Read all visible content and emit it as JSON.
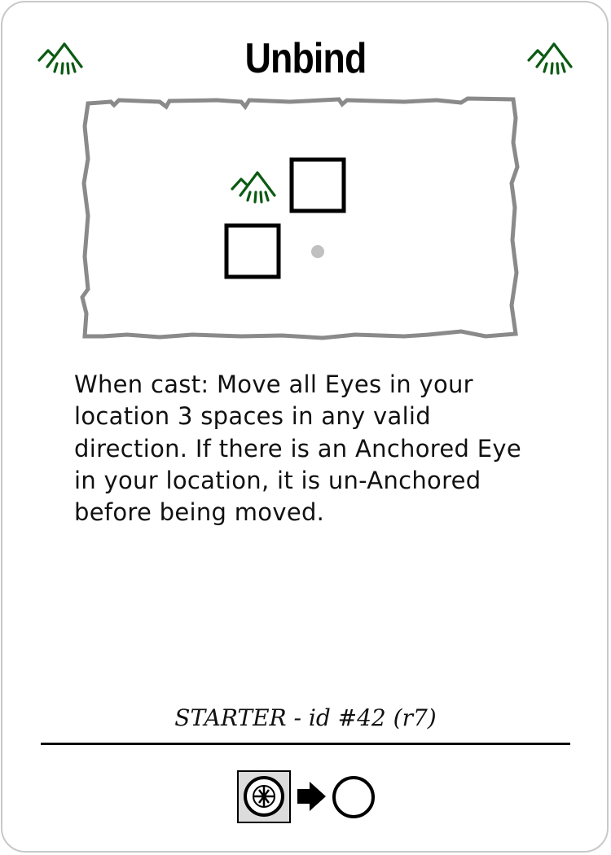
{
  "card": {
    "title": "Unbind",
    "corner_icon": "mountain-element-icon",
    "accent_color": "#0b5a12",
    "diagram": {
      "element_icon": "mountain-element-icon",
      "cells": [
        "empty-square",
        "empty-square"
      ],
      "origin_marker": "grey-dot"
    },
    "description": "When cast: Move all Eyes in your location 3 spaces in any valid direction. If there is an Anchored Eye in your location, it is un-Anchored before being moved.",
    "footer": "STARTER - id #42 (r7)",
    "cost": {
      "from_icon": "crossed-circle-token-icon",
      "arrow_icon": "arrow-right-icon",
      "to_icon": "empty-circle-icon"
    }
  }
}
